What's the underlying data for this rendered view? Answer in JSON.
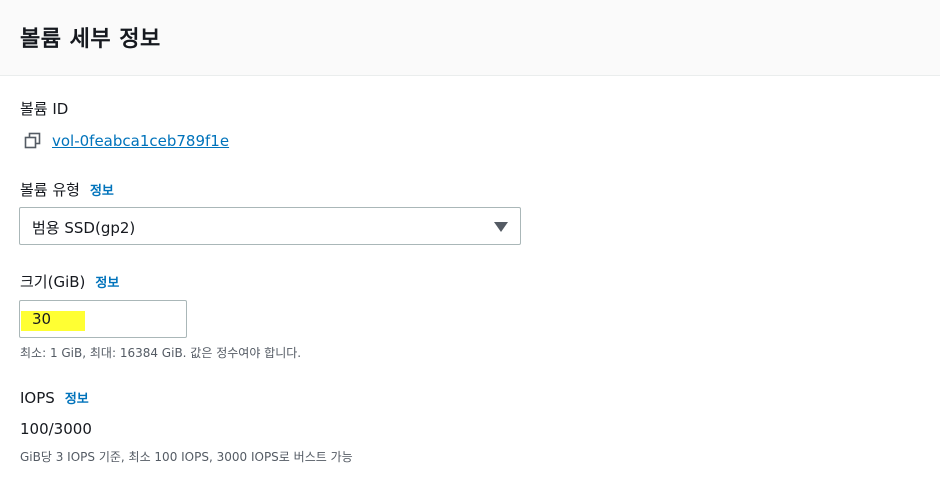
{
  "header": {
    "title": "볼륨 세부 정보"
  },
  "volume_id": {
    "label": "볼륨 ID",
    "value": "vol-0feabca1ceb789f1e",
    "icon": "copy-icon"
  },
  "volume_type": {
    "label": "볼륨 유형",
    "info": "정보",
    "selected": "범용 SSD(gp2)"
  },
  "size": {
    "label": "크기(GiB)",
    "info": "정보",
    "value": "30",
    "highlight_color": "#ffff33",
    "hint": "최소: 1 GiB, 최대: 16384 GiB. 값은 정수여야 합니다."
  },
  "iops": {
    "label": "IOPS",
    "info": "정보",
    "value": "100/3000",
    "hint": "GiB당 3 IOPS 기준, 최소 100 IOPS, 3000 IOPS로 버스트 가능"
  },
  "colors": {
    "link": "#0073bb",
    "text": "#16191f",
    "border": "#aab7b8"
  }
}
